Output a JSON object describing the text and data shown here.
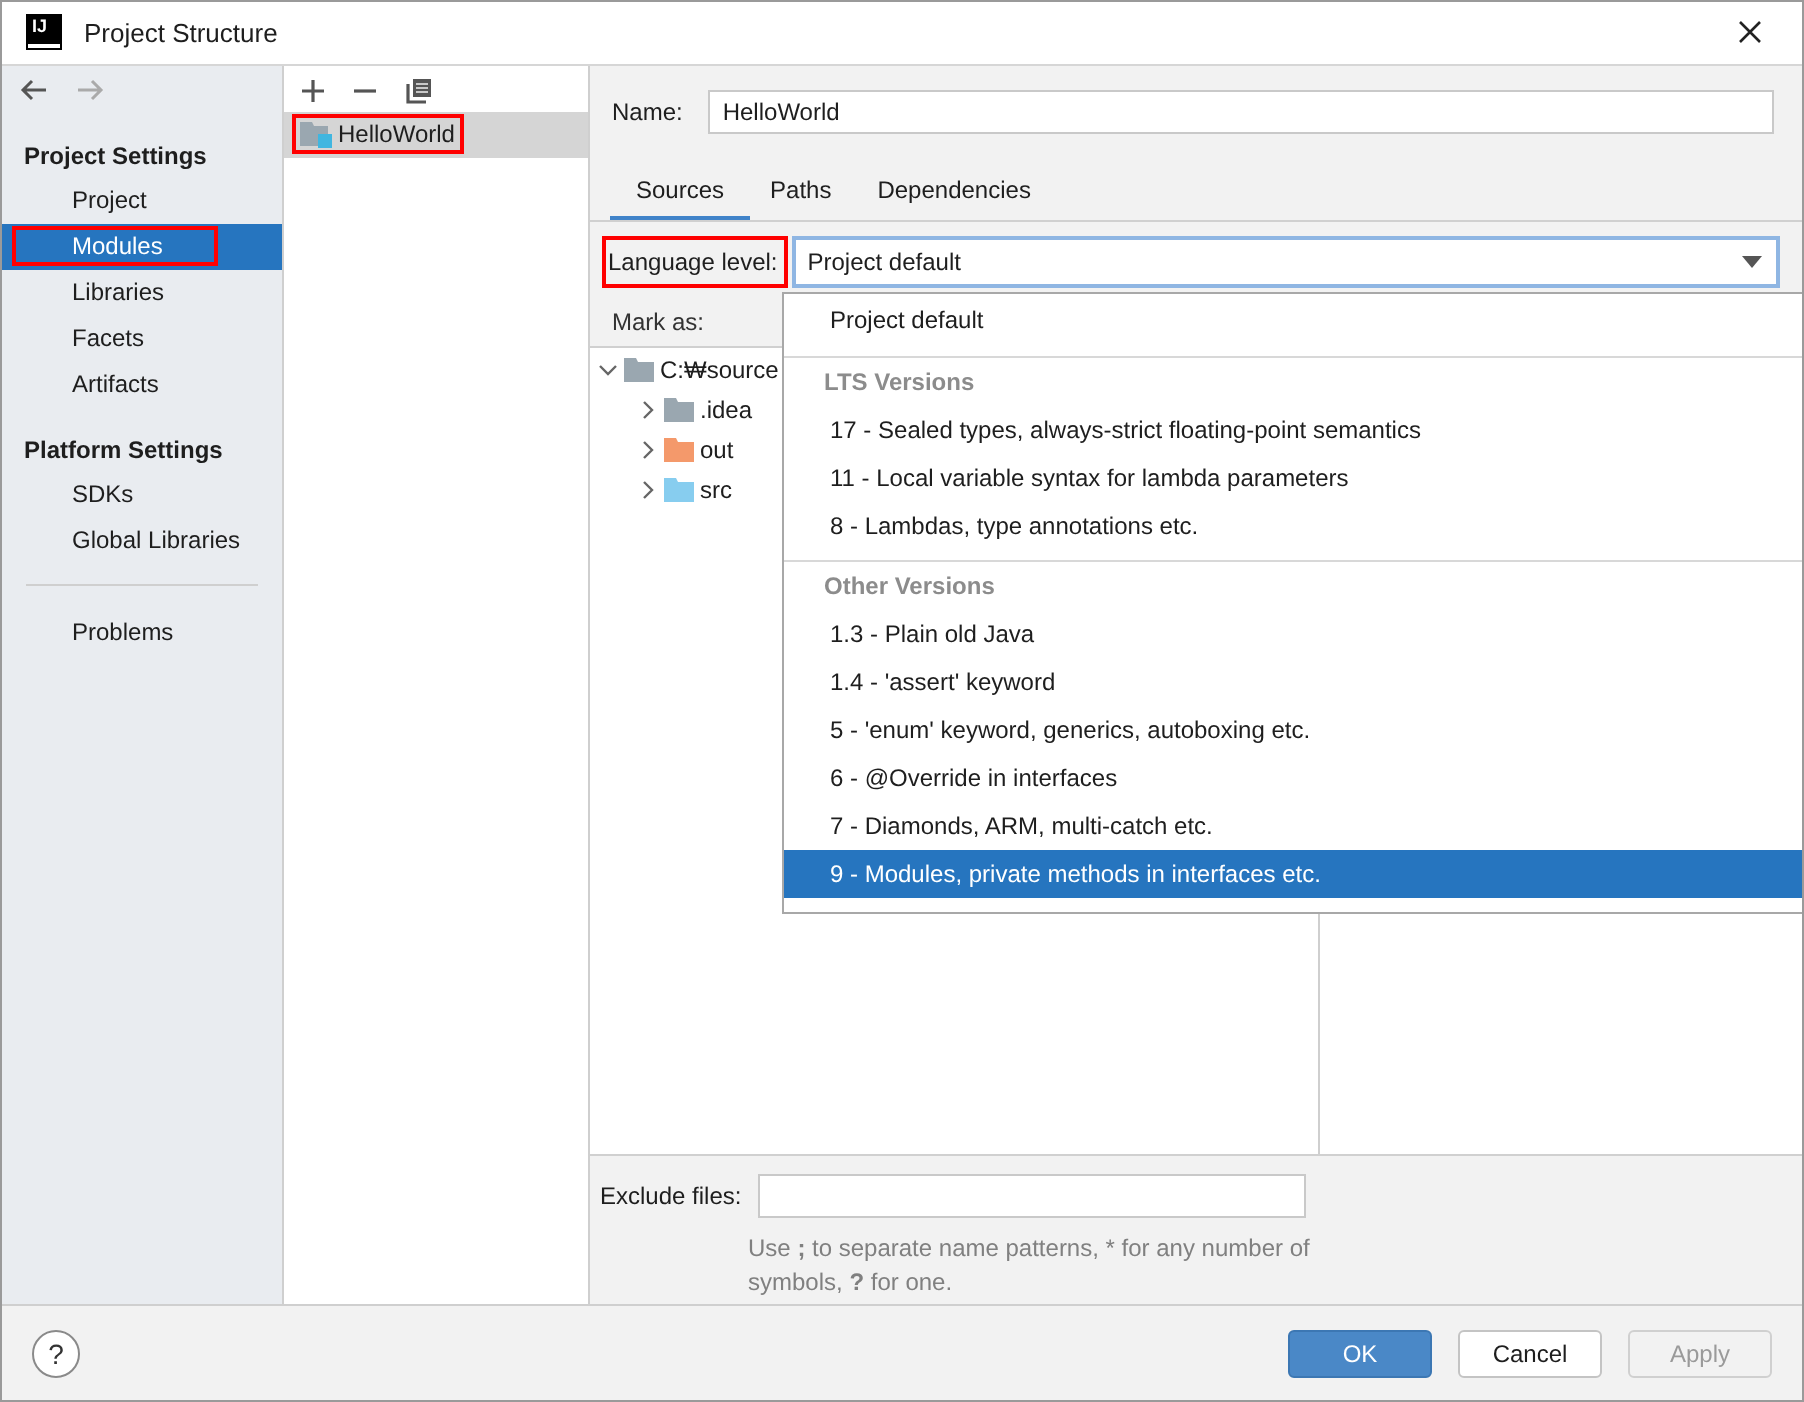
{
  "window": {
    "title": "Project Structure",
    "app_icon": "IJ"
  },
  "sidebar": {
    "sections": [
      {
        "title": "Project Settings",
        "items": [
          {
            "label": "Project",
            "selected": false,
            "highlighted": false
          },
          {
            "label": "Modules",
            "selected": true,
            "highlighted": true
          },
          {
            "label": "Libraries",
            "selected": false,
            "highlighted": false
          },
          {
            "label": "Facets",
            "selected": false,
            "highlighted": false
          },
          {
            "label": "Artifacts",
            "selected": false,
            "highlighted": false
          }
        ]
      },
      {
        "title": "Platform Settings",
        "items": [
          {
            "label": "SDKs",
            "selected": false,
            "highlighted": false
          },
          {
            "label": "Global Libraries",
            "selected": false,
            "highlighted": false
          }
        ]
      }
    ],
    "footer_items": [
      {
        "label": "Problems",
        "selected": false,
        "highlighted": false
      }
    ]
  },
  "modules": [
    {
      "name": "HelloWorld",
      "selected": true,
      "highlighted": true
    }
  ],
  "name_field": {
    "label": "Name:",
    "value": "HelloWorld"
  },
  "tabs": [
    {
      "label": "Sources",
      "selected": true
    },
    {
      "label": "Paths",
      "selected": false
    },
    {
      "label": "Dependencies",
      "selected": false
    }
  ],
  "language_level": {
    "label": "Language level:",
    "value": "Project default",
    "highlighted": true
  },
  "mark_as": {
    "label": "Mark as:"
  },
  "tree": {
    "label": "C:₩source",
    "expanded": true,
    "color": "#9aa7b0",
    "children": [
      {
        "label": ".idea",
        "expanded": false,
        "color": "#9aa7b0"
      },
      {
        "label": "out",
        "expanded": false,
        "color": "#f4996b"
      },
      {
        "label": "src",
        "expanded": false,
        "color": "#87cdef"
      }
    ]
  },
  "dropdown": {
    "groups": [
      {
        "items": [
          {
            "label": "Project default",
            "selected": false
          }
        ]
      },
      {
        "header": "LTS Versions",
        "items": [
          {
            "label": "17 - Sealed types, always-strict floating-point semantics",
            "selected": false
          },
          {
            "label": "11 - Local variable syntax for lambda parameters",
            "selected": false
          },
          {
            "label": "8 - Lambdas, type annotations etc.",
            "selected": false
          }
        ]
      },
      {
        "header": "Other Versions",
        "items": [
          {
            "label": "1.3 - Plain old Java",
            "selected": false
          },
          {
            "label": "1.4 - 'assert' keyword",
            "selected": false
          },
          {
            "label": "5 - 'enum' keyword, generics, autoboxing etc.",
            "selected": false
          },
          {
            "label": "6 - @Override in interfaces",
            "selected": false
          },
          {
            "label": "7 - Diamonds, ARM, multi-catch etc.",
            "selected": false
          },
          {
            "label": "9 - Modules, private methods in interfaces etc.",
            "selected": true
          }
        ]
      }
    ]
  },
  "exclude": {
    "label": "Exclude files:",
    "hint": "Use **;** to separate name patterns, * for any number of symbols, **?** for one."
  },
  "help": "?",
  "buttons": [
    {
      "label": "OK",
      "kind": "primary"
    },
    {
      "label": "Cancel",
      "kind": "normal"
    },
    {
      "label": "Apply",
      "kind": "disabled"
    }
  ]
}
